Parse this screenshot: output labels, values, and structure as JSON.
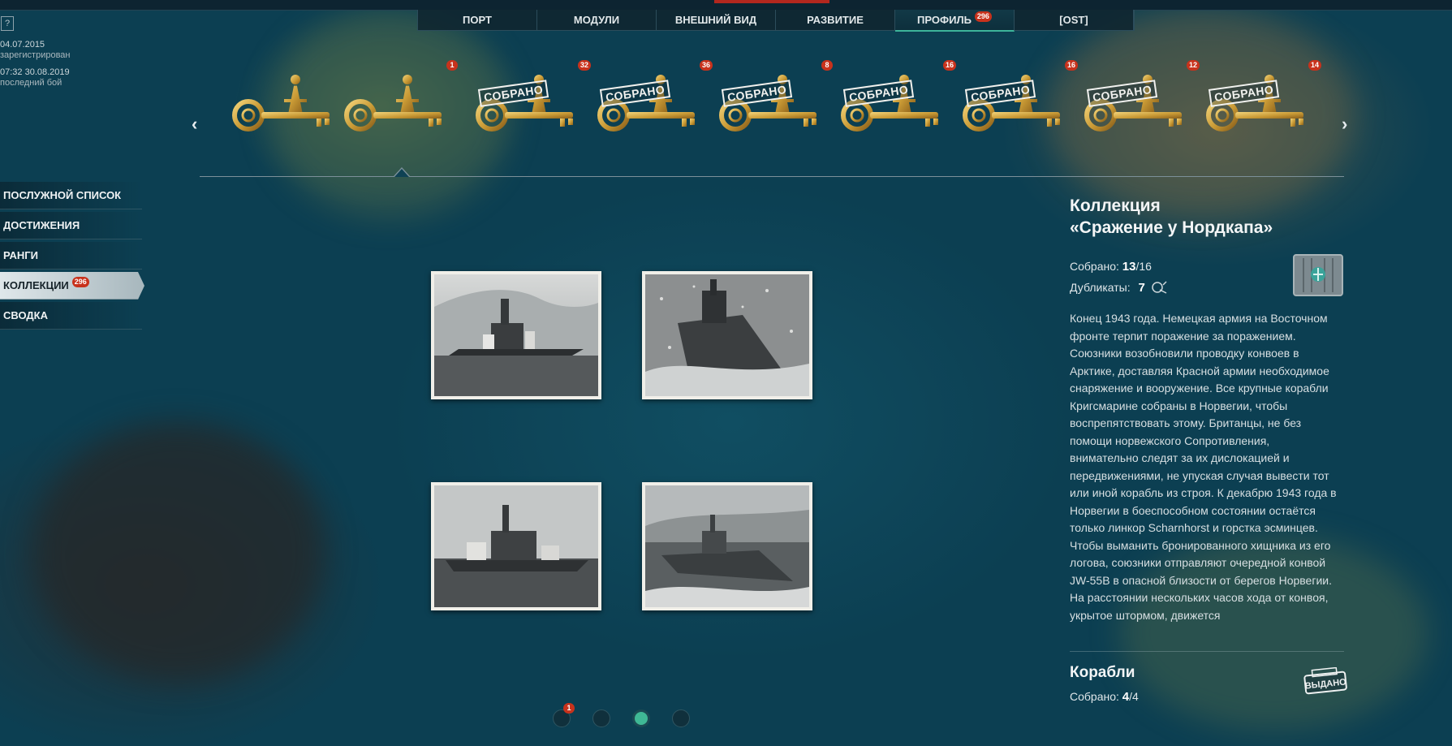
{
  "nav": {
    "tabs": [
      {
        "label": "ПОРТ"
      },
      {
        "label": "МОДУЛИ"
      },
      {
        "label": "ВНЕШНИЙ ВИД"
      },
      {
        "label": "РАЗВИТИЕ"
      },
      {
        "label": "ПРОФИЛЬ",
        "badge": "296",
        "active": true
      },
      {
        "label": "[OST]"
      }
    ]
  },
  "profile_info": {
    "help_label": "?",
    "registered_date": "04.07.2015",
    "registered_label": "зарегистрирован",
    "last_battle_datetime": "07:32  30.08.2019",
    "last_battle_label": "последний бой"
  },
  "collections": {
    "prev_arrow": "‹",
    "next_arrow": "›",
    "stamp_label": "СОБРАНО",
    "items": [
      {
        "badge": "",
        "collected": false,
        "icon": "key-sun-emblem-icon"
      },
      {
        "badge": "1",
        "collected": false,
        "icon": "key-ship-icon"
      },
      {
        "badge": "32",
        "collected": true,
        "icon": "key-anchor-star-icon"
      },
      {
        "badge": "36",
        "collected": true,
        "icon": "key-anchor-hexagon-icon"
      },
      {
        "badge": "8",
        "collected": true,
        "icon": "key-eagle-anchor-icon"
      },
      {
        "badge": "16",
        "collected": true,
        "icon": "key-eagle-icon"
      },
      {
        "badge": "16",
        "collected": true,
        "icon": "key-crossed-anchors-icon"
      },
      {
        "badge": "12",
        "collected": true,
        "icon": "key-number-eight-icon"
      },
      {
        "badge": "14",
        "collected": true,
        "icon": "key-warship-icon"
      }
    ]
  },
  "sidebar": {
    "items": [
      {
        "label": "ПОСЛУЖНОЙ СПИСОК"
      },
      {
        "label": "ДОСТИЖЕНИЯ"
      },
      {
        "label": "РАНГИ"
      },
      {
        "label": "КОЛЛЕКЦИИ",
        "badge": "296",
        "active": true
      },
      {
        "label": "СВОДКА"
      }
    ]
  },
  "photos": [
    {
      "icon": "battleship-photo"
    },
    {
      "icon": "battleship-storm-photo"
    },
    {
      "icon": "cruiser-photo"
    },
    {
      "icon": "destroyer-photo"
    }
  ],
  "panel": {
    "title_line1": "Коллекция",
    "title_line2": "«Сражение у Нордкапа»",
    "collected_label": "Собрано:",
    "collected_value": "13",
    "collected_total": "/16",
    "duplicates_label": "Дубликаты:",
    "duplicates_value": "7",
    "crate_icon": "supply-container-icon",
    "description": "Конец 1943 года. Немецкая армия на Восточном фронте терпит поражение за поражением. Союзники возобновили проводку конвоев в Арктике, доставляя Красной армии необходимое снаряжение и вооружение. Все крупные корабли Кригсмарине собраны в Норвегии, чтобы воспрепятствовать этому. Британцы, не без помощи норвежского Сопротивления, внимательно следят за их дислокацией и передвижениями, не упуская случая вывести тот или иной корабль из строя. К декабрю 1943 года в Норвегии в боеспособном состоянии остаётся только линкор Scharnhorst и горстка эсминцев. Чтобы выманить бронированного хищника из его логова, союзники отправляют очередной конвой JW-55B в опасной близости от берегов Норвегии. На расстоянии нескольких часов хода от конвоя, укрытое штормом, движется",
    "ships_title": "Корабли",
    "ships_collected_label": "Собрано:",
    "ships_collected_value": "4",
    "ships_collected_total": "/4",
    "issued_label": "ВЫДАНО"
  },
  "pager": {
    "pages": [
      {
        "badge": "1",
        "active": false
      },
      {
        "badge": "",
        "active": false
      },
      {
        "badge": "",
        "active": true
      },
      {
        "badge": "",
        "active": false
      }
    ]
  }
}
